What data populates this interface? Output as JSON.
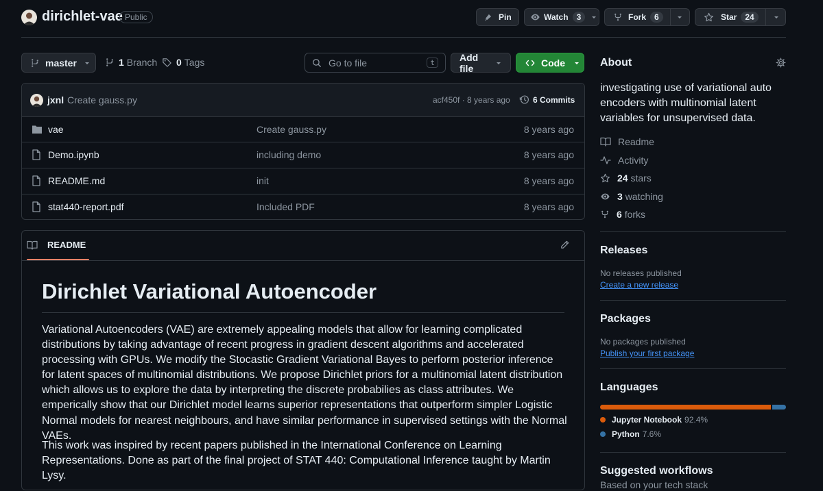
{
  "repo": {
    "name": "dirichlet-vae",
    "visibility": "Public"
  },
  "actions": {
    "pin_label": "Pin",
    "watch_label": "Watch",
    "watch_count": "3",
    "fork_label": "Fork",
    "fork_count": "6",
    "star_label": "Star",
    "star_count": "24"
  },
  "toolbar": {
    "branch": "master",
    "branches_count": "1",
    "branches_label": "Branch",
    "tags_count": "0",
    "tags_label": "Tags",
    "search_placeholder": "Go to file",
    "search_shortcut": "t",
    "add_file_label": "Add file",
    "code_label": "Code"
  },
  "commit": {
    "author": "jxnl",
    "message": "Create gauss.py",
    "hash_time": "acf450f · 8 years ago",
    "commits_label": "6 Commits"
  },
  "files": [
    {
      "type": "folder",
      "name": "vae",
      "message": "Create gauss.py",
      "age": "8 years ago"
    },
    {
      "type": "file",
      "name": "Demo.ipynb",
      "message": "including demo",
      "age": "8 years ago"
    },
    {
      "type": "file",
      "name": "README.md",
      "message": "init",
      "age": "8 years ago"
    },
    {
      "type": "file",
      "name": "stat440-report.pdf",
      "message": "Included PDF",
      "age": "8 years ago"
    }
  ],
  "readme": {
    "tab_label": "README",
    "title": "Dirichlet Variational Autoencoder",
    "paragraph1": "Variational Autoencoders (VAE) are extremely appealing models that allow for learning complicated distributions by taking advantage of recent progress in gradient descent algorithms and accelerated processing with GPUs. We modify the Stocastic Gradient Variational Bayes to perform posterior inference for latent spaces of multinomial distributions. We propose Dirichlet priors for a multinomial latent distribution which allows us to explore the data by interpreting the discrete probabilies as class attributes. We emperically show that our Dirichlet model learns superior representations that outperform simpler Logistic Normal models for nearest neighbours, and have similar performance in supervised settings with the Normal VAEs.",
    "paragraph2": "This work was inspired by recent papers published in the International Conference on Learning Representations. Done as part of the final project of STAT 440: Computational Inference taught by Martin Lysy."
  },
  "about": {
    "heading": "About",
    "description": "investigating use of variational auto encoders with multinomial latent variables for unsupervised data.",
    "readme_label": "Readme",
    "activity_label": "Activity",
    "stars_count": "24",
    "stars_label": "stars",
    "watching_count": "3",
    "watching_label": "watching",
    "forks_count": "6",
    "forks_label": "forks"
  },
  "releases": {
    "heading": "Releases",
    "none_text": "No releases published",
    "create_link": "Create a new release"
  },
  "packages": {
    "heading": "Packages",
    "none_text": "No packages published",
    "publish_link": "Publish your first package"
  },
  "languages": {
    "heading": "Languages",
    "items": [
      {
        "name": "Jupyter Notebook",
        "percent": "92.4%",
        "fraction": 0.924,
        "color": "#da5b0b"
      },
      {
        "name": "Python",
        "percent": "7.6%",
        "fraction": 0.076,
        "color": "#3572a5"
      }
    ]
  },
  "workflows": {
    "heading": "Suggested workflows",
    "subtext": "Based on your tech stack"
  },
  "colors": {
    "code_button": "#238636",
    "tab_underline": "#f78166",
    "link": "#4493f8"
  }
}
